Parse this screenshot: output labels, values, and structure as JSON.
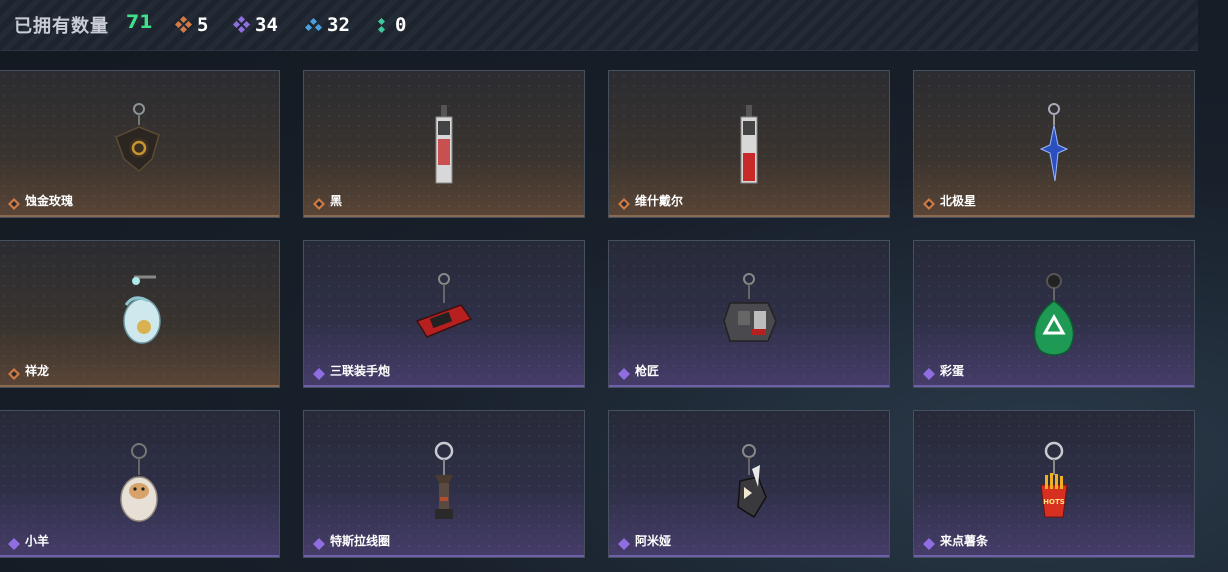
{
  "header": {
    "owned_label": "已拥有数量",
    "owned_count": "71",
    "stats": [
      {
        "icon": "orange-gem-icon",
        "color": "#d07a45",
        "value": "5"
      },
      {
        "icon": "purple-gem-icon",
        "color": "#8e6ee0",
        "value": "34"
      },
      {
        "icon": "blue-gem-icon",
        "color": "#4aa0e0",
        "value": "32"
      },
      {
        "icon": "green-gem-icon",
        "color": "#3fc8a0",
        "value": "0"
      }
    ]
  },
  "items": [
    {
      "name": "蚀金玫瑰",
      "rarity": "orange",
      "charm": "black-rose-charm-icon"
    },
    {
      "name": "黑",
      "rarity": "orange",
      "charm": "black-tag-charm-icon"
    },
    {
      "name": "维什戴尔",
      "rarity": "orange",
      "charm": "red-tag-charm-icon"
    },
    {
      "name": "北极星",
      "rarity": "orange",
      "charm": "blue-star-charm-icon"
    },
    {
      "name": "祥龙",
      "rarity": "orange",
      "charm": "dragon-charm-icon"
    },
    {
      "name": "三联装手炮",
      "rarity": "purple",
      "charm": "hand-cannon-charm-icon"
    },
    {
      "name": "枪匠",
      "rarity": "purple",
      "charm": "gunsmith-charm-icon"
    },
    {
      "name": "彩蛋",
      "rarity": "purple",
      "charm": "easter-egg-charm-icon"
    },
    {
      "name": "小羊",
      "rarity": "purple",
      "charm": "lamb-charm-icon"
    },
    {
      "name": "特斯拉线圈",
      "rarity": "purple",
      "charm": "tesla-coil-charm-icon"
    },
    {
      "name": "阿米娅",
      "rarity": "purple",
      "charm": "amiya-charm-icon"
    },
    {
      "name": "来点薯条",
      "rarity": "purple",
      "charm": "fries-charm-icon"
    }
  ],
  "colors": {
    "orange_rarity": "#d07a45",
    "purple_rarity": "#8e6ee0",
    "owned_count": "#3fe08a"
  }
}
